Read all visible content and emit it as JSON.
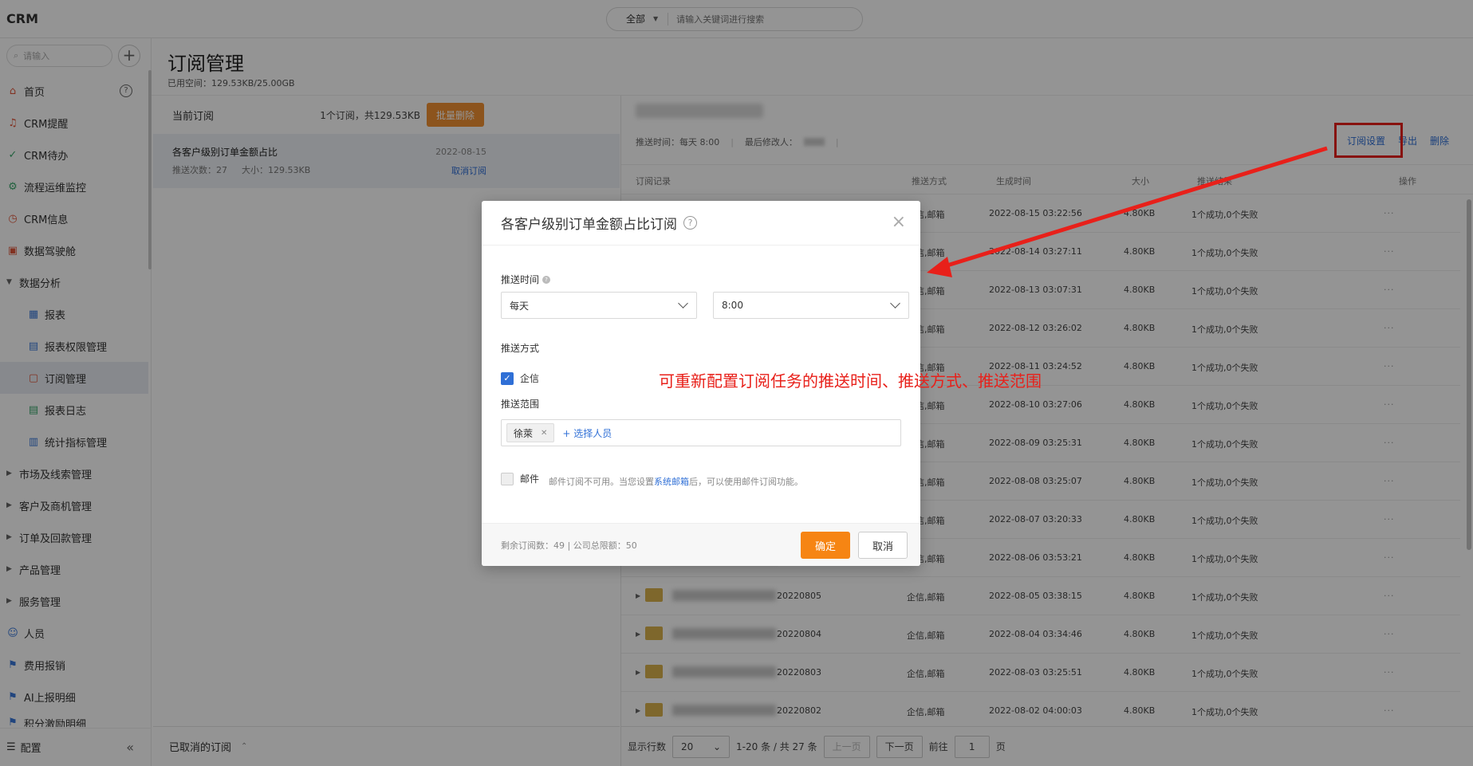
{
  "app": {
    "logo": "CRM"
  },
  "global_search": {
    "scope": "全部",
    "placeholder": "请输入关键词进行搜索"
  },
  "sidebar": {
    "search_placeholder": "请输入",
    "items": [
      {
        "label": "首页",
        "icon": "home-icon"
      },
      {
        "label": "CRM提醒",
        "icon": "bell-icon"
      },
      {
        "label": "CRM待办",
        "icon": "check-circle-icon"
      },
      {
        "label": "流程运维监控",
        "icon": "flow-icon"
      },
      {
        "label": "CRM信息",
        "icon": "clock-icon"
      },
      {
        "label": "数据驾驶舱",
        "icon": "dashboard-icon"
      },
      {
        "label": "数据分析",
        "icon": "expand-icon"
      },
      {
        "label": "报表",
        "icon": "report-icon"
      },
      {
        "label": "报表权限管理",
        "icon": "permission-icon"
      },
      {
        "label": "订阅管理",
        "icon": "subscribe-icon"
      },
      {
        "label": "报表日志",
        "icon": "log-icon"
      },
      {
        "label": "统计指标管理",
        "icon": "metric-icon"
      },
      {
        "label": "市场及线索管理",
        "icon": "collapse-icon"
      },
      {
        "label": "客户及商机管理",
        "icon": "collapse-icon"
      },
      {
        "label": "订单及回款管理",
        "icon": "collapse-icon"
      },
      {
        "label": "产品管理",
        "icon": "collapse-icon"
      },
      {
        "label": "服务管理",
        "icon": "collapse-icon"
      },
      {
        "label": "人员",
        "icon": "people-icon"
      },
      {
        "label": "费用报销",
        "icon": "flag-icon"
      },
      {
        "label": "AI上报明细",
        "icon": "flag-icon"
      },
      {
        "label": "积分激励明细",
        "icon": "flag-icon"
      }
    ],
    "footer_label": "配置"
  },
  "page": {
    "title": "订阅管理",
    "usage": "已用空间：129.53KB/25.00GB"
  },
  "list_panel": {
    "header": "当前订阅",
    "count": "1个订阅，共129.53KB",
    "bulk_delete": "批量删除",
    "item": {
      "title": "各客户级别订单金额占比",
      "push_count": "推送次数：27",
      "size": "大小：129.53KB",
      "date": "2022-08-15",
      "cancel": "取消订阅"
    },
    "footer": "已取消的订阅"
  },
  "detail": {
    "push_time": "推送时间：每天 8:00",
    "last_modifier": "最后修改人：",
    "actions": {
      "settings": "订阅设置",
      "export": "导出",
      "delete": "删除"
    },
    "columns": {
      "record": "订阅记录",
      "method": "推送方式",
      "created": "生成时间",
      "size": "大小",
      "result": "推送结果",
      "ops": "操作"
    },
    "rows": [
      {
        "name": "",
        "method": "企信,邮箱",
        "time": "2022-08-15 03:22:56",
        "size": "4.80KB",
        "result": "1个成功,0个失败"
      },
      {
        "name": "",
        "method": "企信,邮箱",
        "time": "2022-08-14 03:27:11",
        "size": "4.80KB",
        "result": "1个成功,0个失败"
      },
      {
        "name": "",
        "method": "企信,邮箱",
        "time": "2022-08-13 03:07:31",
        "size": "4.80KB",
        "result": "1个成功,0个失败"
      },
      {
        "name": "",
        "method": "企信,邮箱",
        "time": "2022-08-12 03:26:02",
        "size": "4.80KB",
        "result": "1个成功,0个失败"
      },
      {
        "name": "",
        "method": "企信,邮箱",
        "time": "2022-08-11 03:24:52",
        "size": "4.80KB",
        "result": "1个成功,0个失败"
      },
      {
        "name": "",
        "method": "企信,邮箱",
        "time": "2022-08-10 03:27:06",
        "size": "4.80KB",
        "result": "1个成功,0个失败"
      },
      {
        "name": "",
        "method": "企信,邮箱",
        "time": "2022-08-09 03:25:31",
        "size": "4.80KB",
        "result": "1个成功,0个失败"
      },
      {
        "name": "",
        "method": "企信,邮箱",
        "time": "2022-08-08 03:25:07",
        "size": "4.80KB",
        "result": "1个成功,0个失败"
      },
      {
        "name": "",
        "method": "企信,邮箱",
        "time": "2022-08-07 03:20:33",
        "size": "4.80KB",
        "result": "1个成功,0个失败"
      },
      {
        "name": "",
        "method": "企信,邮箱",
        "time": "2022-08-06 03:53:21",
        "size": "4.80KB",
        "result": "1个成功,0个失败"
      },
      {
        "name": "20220805",
        "method": "企信,邮箱",
        "time": "2022-08-05 03:38:15",
        "size": "4.80KB",
        "result": "1个成功,0个失败"
      },
      {
        "name": "20220804",
        "method": "企信,邮箱",
        "time": "2022-08-04 03:34:46",
        "size": "4.80KB",
        "result": "1个成功,0个失败"
      },
      {
        "name": "20220803",
        "method": "企信,邮箱",
        "time": "2022-08-03 03:25:51",
        "size": "4.80KB",
        "result": "1个成功,0个失败"
      },
      {
        "name": "20220802",
        "method": "企信,邮箱",
        "time": "2022-08-02 04:00:03",
        "size": "4.80KB",
        "result": "1个成功,0个失败"
      }
    ],
    "more": "···"
  },
  "pager": {
    "rows_label": "显示行数",
    "rows_value": "20",
    "range": "1-20 条 / 共 27 条",
    "prev": "上一页",
    "next": "下一页",
    "goto_label": "前往",
    "page": "1",
    "page_suffix": "页"
  },
  "modal": {
    "title": "各客户级别订单金额占比订阅",
    "push_time_label": "推送时间",
    "frequency": "每天",
    "time": "8:00",
    "method_label": "推送方式",
    "qixin_label": "企信",
    "qixin_checked": true,
    "scope_label": "推送范围",
    "scope_person": "徐萊",
    "add_person": "+ 选择人员",
    "mail_label": "邮件",
    "mail_checked": false,
    "mail_note_pre": "邮件订阅不可用。当您设置",
    "mail_note_link": "系统邮箱",
    "mail_note_post": "后，可以使用邮件订阅功能。",
    "quota": "剩余订阅数：49 | 公司总限额：50",
    "confirm": "确定",
    "cancel": "取消"
  },
  "annotation": {
    "text": "可重新配置订阅任务的推送时间、推送方式、推送范围",
    "color": "#e8201a"
  }
}
